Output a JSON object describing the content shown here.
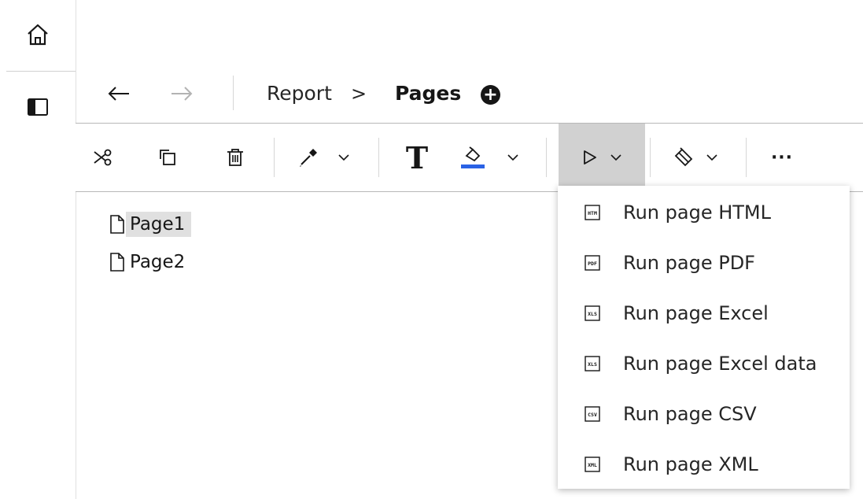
{
  "rail": {
    "home_icon": "home-icon",
    "panel_icon": "side-panel-icon"
  },
  "nav": {
    "back_icon": "arrow-left-icon",
    "forward_icon": "arrow-right-icon",
    "breadcrumb_root": "Report",
    "breadcrumb_separator": ">",
    "breadcrumb_current": "Pages",
    "add_icon": "add-circle-icon"
  },
  "toolbar": {
    "buttons": [
      "cut-icon",
      "copy-icon",
      "delete-icon",
      "eyedropper-icon",
      "text-icon",
      "fill-color-icon",
      "run-icon",
      "brush-icon"
    ],
    "more_label": "···",
    "fill_color": "#2a62e5"
  },
  "tree": {
    "items": [
      {
        "label": "Page1",
        "selected": true
      },
      {
        "label": "Page2",
        "selected": false
      }
    ]
  },
  "run_menu": {
    "items": [
      {
        "label": "Run page HTML",
        "icon_text": "HTM"
      },
      {
        "label": "Run page PDF",
        "icon_text": "PDF"
      },
      {
        "label": "Run page Excel",
        "icon_text": "XLS"
      },
      {
        "label": "Run page Excel data",
        "icon_text": "XLS"
      },
      {
        "label": "Run page CSV",
        "icon_text": "CSV"
      },
      {
        "label": "Run page XML",
        "icon_text": "XML"
      }
    ]
  }
}
